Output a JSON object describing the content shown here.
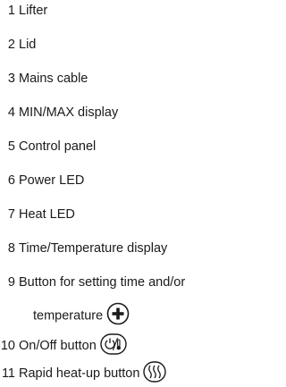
{
  "legend": {
    "items": [
      {
        "num": "1",
        "label": "Lifter"
      },
      {
        "num": "2",
        "label": "Lid"
      },
      {
        "num": "3",
        "label": "Mains cable"
      },
      {
        "num": "4",
        "label": "MIN/MAX display"
      },
      {
        "num": "5",
        "label": "Control panel"
      },
      {
        "num": "6",
        "label": "Power LED"
      },
      {
        "num": "7",
        "label": "Heat LED"
      },
      {
        "num": "8",
        "label": "Time/Temperature display"
      },
      {
        "num": "9",
        "label": "Button for setting time and/or",
        "cont": "temperature"
      },
      {
        "num": "10",
        "label": "On/Off button"
      },
      {
        "num": "11",
        "label": "Rapid heat-up button"
      }
    ]
  },
  "icons": {
    "plus": "plus-circle-icon",
    "power": "power-thermometer-icon",
    "rapid": "heat-waves-icon"
  }
}
